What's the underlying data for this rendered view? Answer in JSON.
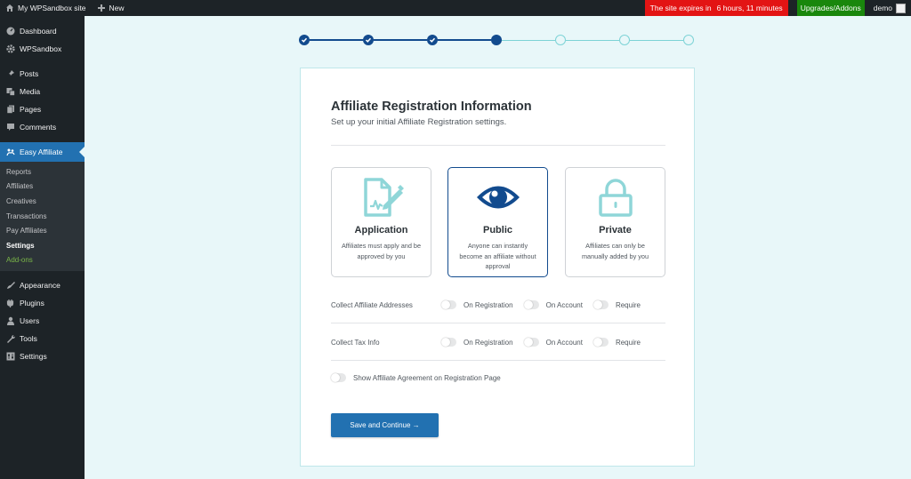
{
  "adminbar": {
    "site_name": "My WPSandbox site",
    "new_label": "New",
    "expires_label": "The site expires in",
    "expires_time": "6 hours, 11 minutes",
    "upgrades_label": "Upgrades/Addons",
    "user_name": "demo",
    "colors": {
      "expires_bg": "#e31414",
      "upgrades_bg": "#19870c"
    }
  },
  "sidebar": {
    "items_top": [
      {
        "label": "Dashboard",
        "icon": "dashboard-icon"
      },
      {
        "label": "WPSandbox",
        "icon": "gear-icon"
      },
      {
        "label": "Posts",
        "icon": "pin-icon"
      },
      {
        "label": "Media",
        "icon": "media-icon"
      },
      {
        "label": "Pages",
        "icon": "pages-icon"
      },
      {
        "label": "Comments",
        "icon": "comment-icon"
      }
    ],
    "active_item": {
      "label": "Easy Affiliate",
      "icon": "easy-affiliate-icon"
    },
    "submenu": [
      {
        "label": "Reports"
      },
      {
        "label": "Affiliates"
      },
      {
        "label": "Creatives"
      },
      {
        "label": "Transactions"
      },
      {
        "label": "Pay Affiliates"
      },
      {
        "label": "Settings",
        "current": true
      },
      {
        "label": "Add-ons"
      }
    ],
    "items_bottom": [
      {
        "label": "Appearance",
        "icon": "brush-icon"
      },
      {
        "label": "Plugins",
        "icon": "plugin-icon"
      },
      {
        "label": "Users",
        "icon": "users-icon"
      },
      {
        "label": "Tools",
        "icon": "wrench-icon"
      },
      {
        "label": "Settings",
        "icon": "settings-icon"
      }
    ]
  },
  "stepper": {
    "total_steps": 7,
    "completed_steps": 3,
    "current_step": 4,
    "colors": {
      "done": "#124b8e",
      "todo": "#7dd3d6"
    }
  },
  "main": {
    "title": "Affiliate Registration Information",
    "subtitle": "Set up your initial Affiliate Registration settings.",
    "options": [
      {
        "title": "Application",
        "description": "Affiliates must apply and be approved by you",
        "icon": "application-form-icon",
        "selected": false
      },
      {
        "title": "Public",
        "description": "Anyone can instantly become an affiliate without approval",
        "icon": "eye-icon",
        "selected": true
      },
      {
        "title": "Private",
        "description": "Affiliates can only be manually added by you",
        "icon": "lock-icon",
        "selected": false
      }
    ],
    "settings": [
      {
        "label": "Collect Affiliate Addresses",
        "toggles": [
          {
            "label": "On Registration",
            "on": false
          },
          {
            "label": "On Account",
            "on": false
          },
          {
            "label": "Require",
            "on": false
          }
        ]
      },
      {
        "label": "Collect Tax Info",
        "toggles": [
          {
            "label": "On Registration",
            "on": false
          },
          {
            "label": "On Account",
            "on": false
          },
          {
            "label": "Require",
            "on": false
          }
        ]
      }
    ],
    "agreement_toggle": {
      "label": "Show Affiliate Agreement on Registration Page",
      "on": false
    },
    "save_button": "Save and Continue →",
    "colors": {
      "accent": "#124b8e",
      "icon_teal": "#8fd6d8",
      "button": "#2271b1"
    }
  }
}
